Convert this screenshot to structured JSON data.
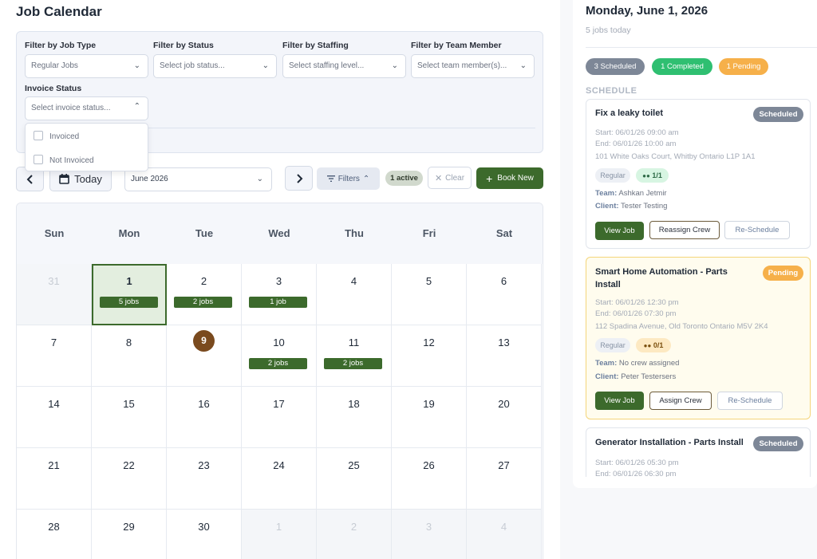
{
  "page": {
    "title": "Job Calendar"
  },
  "filters": {
    "job_type": {
      "label": "Filter by Job Type",
      "value": "Regular Jobs"
    },
    "status": {
      "label": "Filter by Status",
      "placeholder": "Select job status..."
    },
    "staffing": {
      "label": "Filter by Staffing",
      "placeholder": "Select staffing level..."
    },
    "team_member": {
      "label": "Filter by Team Member",
      "placeholder": "Select team member(s)..."
    },
    "invoice": {
      "label": "Invoice Status",
      "placeholder": "Select invoice status...",
      "options": [
        "Invoiced",
        "Not Invoiced"
      ]
    }
  },
  "toolbar": {
    "prev_icon": "chevron-left-icon",
    "today_label": "Today",
    "month_value": "June 2026",
    "next_icon": "chevron-right-icon",
    "filters_label": "Filters",
    "active_count": "1 active",
    "clear_label": "Clear",
    "book_new_label": "Book New"
  },
  "calendar": {
    "weekdays": [
      "Sun",
      "Mon",
      "Tue",
      "Wed",
      "Thu",
      "Fri",
      "Sat"
    ],
    "weeks": [
      [
        {
          "day": "31",
          "out": true
        },
        {
          "day": "1",
          "jobs": "5 jobs",
          "selected": true
        },
        {
          "day": "2",
          "jobs": "2 jobs"
        },
        {
          "day": "3",
          "jobs": "1 job"
        },
        {
          "day": "4"
        },
        {
          "day": "5"
        },
        {
          "day": "6"
        }
      ],
      [
        {
          "day": "7"
        },
        {
          "day": "8"
        },
        {
          "day": "9",
          "today": true
        },
        {
          "day": "10",
          "jobs": "2 jobs"
        },
        {
          "day": "11",
          "jobs": "2 jobs"
        },
        {
          "day": "12"
        },
        {
          "day": "13"
        }
      ],
      [
        {
          "day": "14"
        },
        {
          "day": "15"
        },
        {
          "day": "16"
        },
        {
          "day": "17"
        },
        {
          "day": "18"
        },
        {
          "day": "19"
        },
        {
          "day": "20"
        }
      ],
      [
        {
          "day": "21"
        },
        {
          "day": "22"
        },
        {
          "day": "23"
        },
        {
          "day": "24"
        },
        {
          "day": "25"
        },
        {
          "day": "26"
        },
        {
          "day": "27"
        }
      ],
      [
        {
          "day": "28"
        },
        {
          "day": "29"
        },
        {
          "day": "30"
        },
        {
          "day": "1",
          "out": true
        },
        {
          "day": "2",
          "out": true
        },
        {
          "day": "3",
          "out": true
        },
        {
          "day": "4",
          "out": true
        }
      ]
    ]
  },
  "day_panel": {
    "date_title": "Monday, June 1, 2026",
    "jobs_count": "5 jobs today",
    "badges": {
      "scheduled": "3 Scheduled",
      "completed": "1 Completed",
      "pending": "1 Pending"
    },
    "schedule_heading": "SCHEDULE",
    "jobs": [
      {
        "name": "Fix a leaky toilet",
        "status": "Scheduled",
        "start": "Start: 06/01/26 09:00 am",
        "end": "End: 06/01/26 10:00 am",
        "address": "101 White Oaks Court, Whitby Ontario L1P 1A1",
        "type": "Regular",
        "crew": "1/1",
        "team_label": "Team:",
        "team": "Ashkan Jetmir",
        "client_label": "Client:",
        "client": "Tester Testing",
        "btn_view": "View Job",
        "btn_crew": "Reassign Crew",
        "btn_reschedule": "Re-Schedule"
      },
      {
        "name": "Smart Home Automation - Parts Install",
        "status": "Pending",
        "start": "Start: 06/01/26 12:30 pm",
        "end": "End: 06/01/26 07:30 pm",
        "address": "112 Spadina Avenue, Old Toronto Ontario M5V 2K4",
        "type": "Regular",
        "crew": "0/1",
        "team_label": "Team:",
        "team": "No crew assigned",
        "client_label": "Client:",
        "client": "Peter Testersers",
        "btn_view": "View Job",
        "btn_crew": "Assign Crew",
        "btn_reschedule": "Re-Schedule"
      },
      {
        "name": "Generator Installation - Parts Install",
        "status": "Scheduled",
        "start": "Start: 06/01/26 05:30 pm",
        "end": "End: 06/01/26 06:30 pm"
      }
    ]
  },
  "colors": {
    "primary_green": "#3c6a2c",
    "scheduled_gray": "#7d8797",
    "completed_green": "#2fbf71",
    "pending_amber": "#f6b04a",
    "today_brown": "#7a4a1e"
  }
}
